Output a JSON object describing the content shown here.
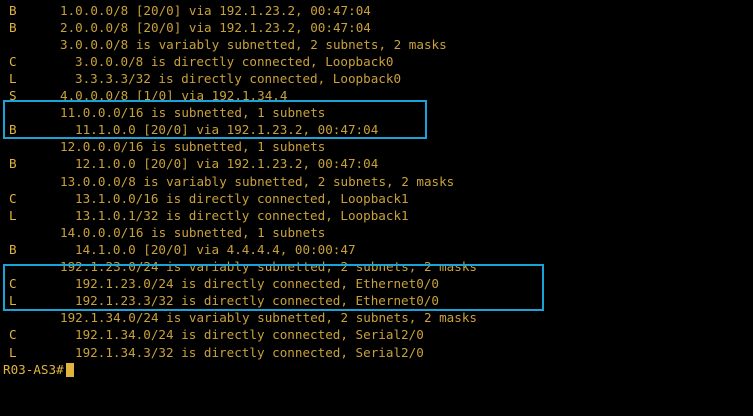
{
  "terminal": {
    "lines": [
      {
        "code": "B",
        "text": "1.0.0.0/8 [20/0] via 192.1.23.2, 00:47:04"
      },
      {
        "code": "B",
        "text": "2.0.0.0/8 [20/0] via 192.1.23.2, 00:47:04"
      },
      {
        "code": "",
        "text": "3.0.0.0/8 is variably subnetted, 2 subnets, 2 masks"
      },
      {
        "code": "C",
        "text": "3.0.0.0/8 is directly connected, Loopback0"
      },
      {
        "code": "L",
        "text": "3.3.3.3/32 is directly connected, Loopback0"
      },
      {
        "code": "S",
        "text": "4.0.0.0/8 [1/0] via 192.1.34.4"
      },
      {
        "code": "",
        "text": "11.0.0.0/16 is subnetted, 1 subnets"
      },
      {
        "code": "B",
        "text": "11.1.0.0 [20/0] via 192.1.23.2, 00:47:04"
      },
      {
        "code": "",
        "text": "12.0.0.0/16 is subnetted, 1 subnets"
      },
      {
        "code": "B",
        "text": "12.1.0.0 [20/0] via 192.1.23.2, 00:47:04"
      },
      {
        "code": "",
        "text": "13.0.0.0/8 is variably subnetted, 2 subnets, 2 masks"
      },
      {
        "code": "C",
        "text": "13.1.0.0/16 is directly connected, Loopback1"
      },
      {
        "code": "L",
        "text": "13.1.0.1/32 is directly connected, Loopback1"
      },
      {
        "code": "",
        "text": "14.0.0.0/16 is subnetted, 1 subnets"
      },
      {
        "code": "B",
        "text": "14.1.0.0 [20/0] via 4.4.4.4, 00:00:47"
      },
      {
        "code": "",
        "text": "192.1.23.0/24 is variably subnetted, 2 subnets, 2 masks"
      },
      {
        "code": "C",
        "text": "192.1.23.0/24 is directly connected, Ethernet0/0"
      },
      {
        "code": "L",
        "text": "192.1.23.3/32 is directly connected, Ethernet0/0"
      },
      {
        "code": "",
        "text": "192.1.34.0/24 is variably subnetted, 2 subnets, 2 masks"
      },
      {
        "code": "C",
        "text": "192.1.34.0/24 is directly connected, Serial2/0"
      },
      {
        "code": "L",
        "text": "192.1.34.3/32 is directly connected, Serial2/0"
      }
    ],
    "prompt": "R03-AS3#"
  },
  "colors": {
    "background": "#000000",
    "text": "#c8a13b",
    "code": "#e0b43f",
    "highlight": "#1aa3d6"
  }
}
